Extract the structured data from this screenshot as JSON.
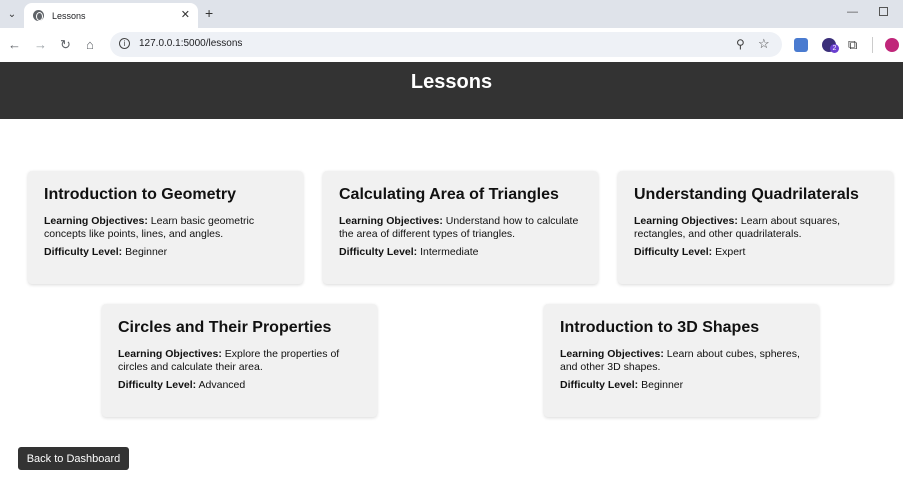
{
  "browser": {
    "tab_title": "Lessons",
    "url": "127.0.0.1:5000/lessons",
    "extension_badge": "2"
  },
  "page": {
    "title": "Lessons",
    "objectives_label": "Learning Objectives:",
    "difficulty_label": "Difficulty Level:",
    "back_button": "Back to Dashboard"
  },
  "lessons": [
    {
      "title": "Introduction to Geometry",
      "objectives": "Learn basic geometric concepts like points, lines, and angles.",
      "difficulty": "Beginner"
    },
    {
      "title": "Calculating Area of Triangles",
      "objectives": "Understand how to calculate the area of different types of triangles.",
      "difficulty": "Intermediate"
    },
    {
      "title": "Understanding Quadrilaterals",
      "objectives": "Learn about squares, rectangles, and other quadrilaterals.",
      "difficulty": "Expert"
    },
    {
      "title": "Circles and Their Properties",
      "objectives": "Explore the properties of circles and calculate their area.",
      "difficulty": "Advanced"
    },
    {
      "title": "Introduction to 3D Shapes",
      "objectives": "Learn about cubes, spheres, and other 3D shapes.",
      "difficulty": "Beginner"
    }
  ],
  "colors": {
    "header_bg": "#333333",
    "card_bg": "#f1f1f1",
    "button_bg": "#333333"
  }
}
